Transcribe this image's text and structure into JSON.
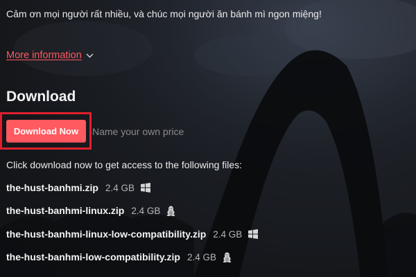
{
  "thanks_text": "Cảm ơn mọi người rất nhiều, và chúc mọi người ăn bánh mì ngon miệng!",
  "more_info_label": "More information",
  "download_heading": "Download",
  "download_button_label": "Download Now",
  "price_label": "Name your own price",
  "instructions": "Click download now to get access to the following files:",
  "files": [
    {
      "name": "the-hust-banhmi.zip",
      "size": "2.4 GB",
      "platform_icon": "windows-icon"
    },
    {
      "name": "the-hust-banhmi-linux.zip",
      "size": "2.4 GB",
      "platform_icon": "linux-icon"
    },
    {
      "name": "the-hust-banhmi-linux-low-compatibility.zip",
      "size": "2.4 GB",
      "platform_icon": "windows-icon"
    },
    {
      "name": "the-hust-banhmi-low-compatibility.zip",
      "size": "2.4 GB",
      "platform_icon": "linux-icon"
    }
  ],
  "colors": {
    "accent": "#ff5a60",
    "highlight_border": "#e0202d",
    "background": "#141414"
  }
}
